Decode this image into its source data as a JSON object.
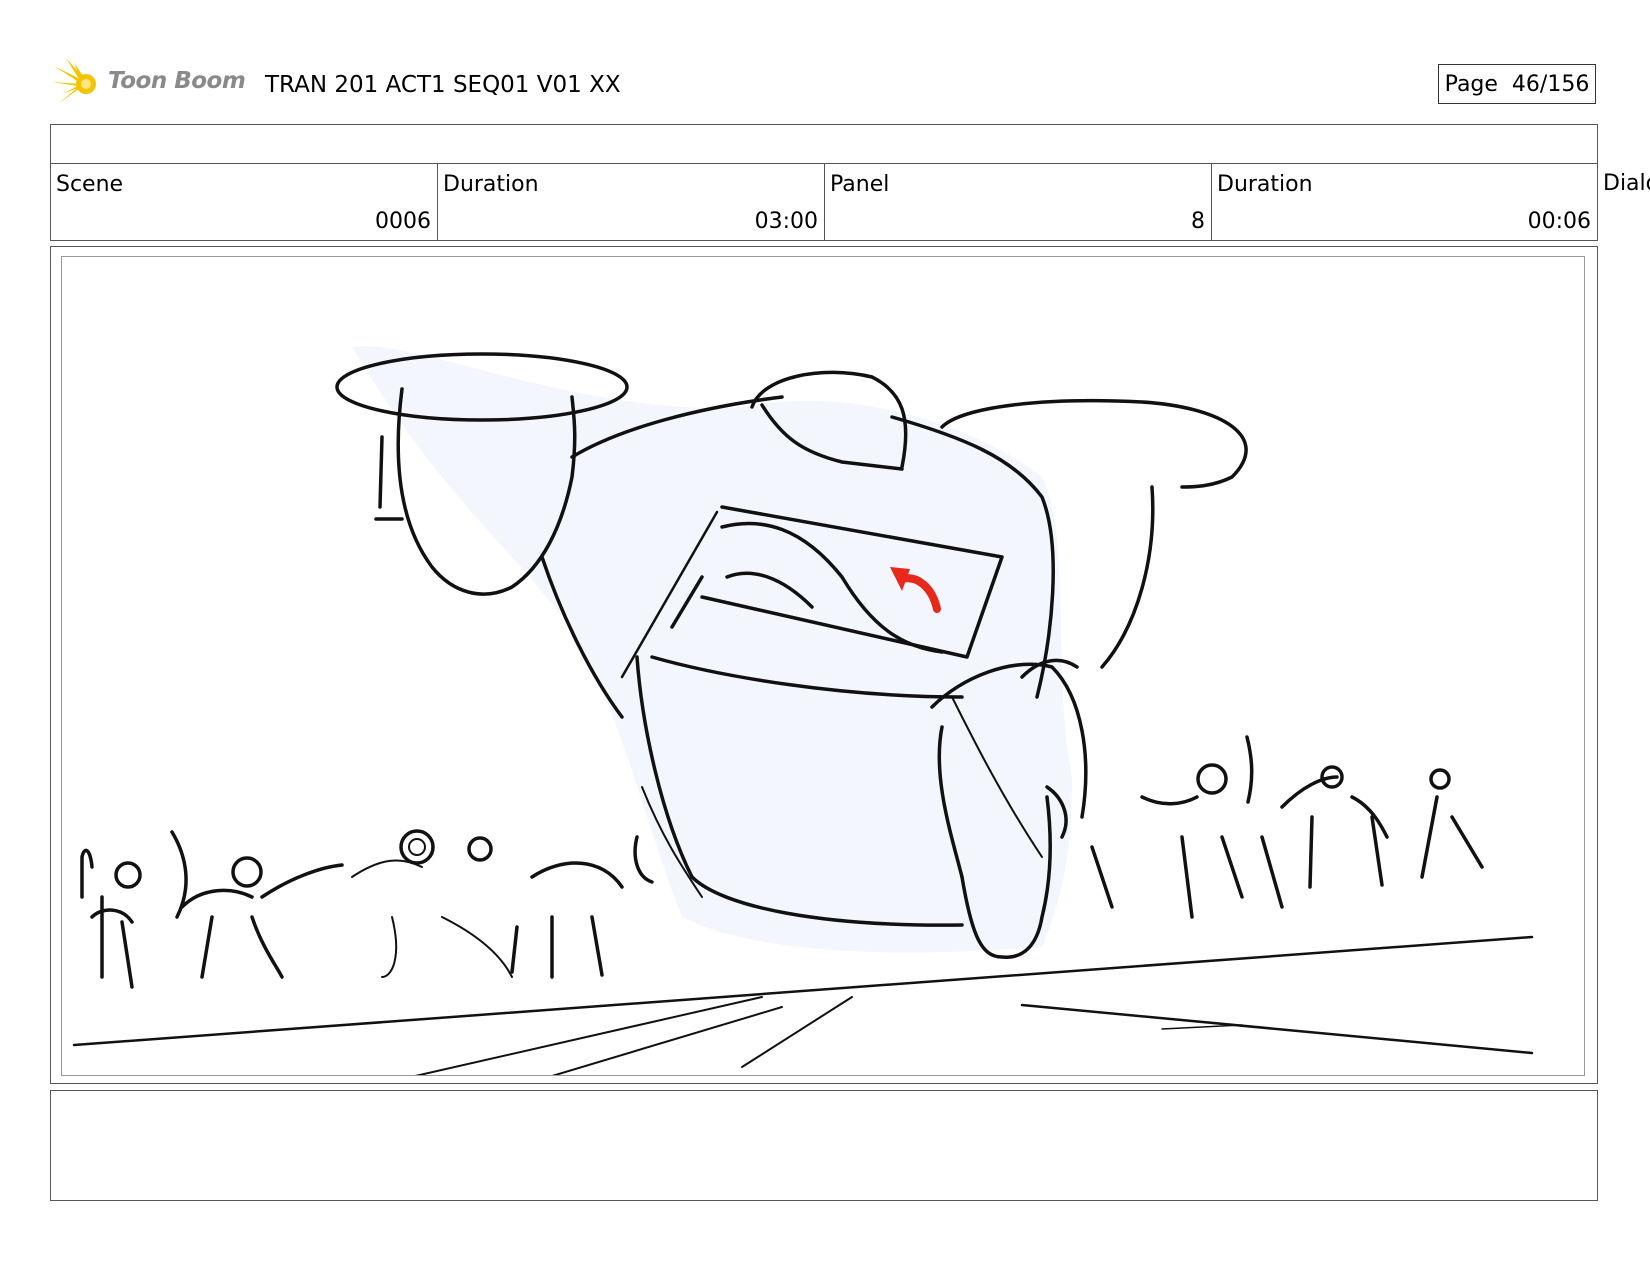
{
  "header": {
    "logo_text": "Toon Boom",
    "doc_title": "TRAN 201 ACT1 SEQ01 V01 XX",
    "page_label": "Page  46/156"
  },
  "info": {
    "scene_label": "Scene",
    "scene_value": "0006",
    "scene_duration_label": "Duration",
    "scene_duration_value": "03:00",
    "panel_label": "Panel",
    "panel_value": "8",
    "panel_duration_label": "Duration",
    "panel_duration_value": "00:06",
    "dialog_label": "Dialo"
  },
  "colors": {
    "logo_star": "#f5c400",
    "arrow_red": "#e8281a",
    "sketch_fill": "#f3f6fc"
  },
  "icons": {
    "logo": "toon-boom-starburst-icon",
    "motion": "red-curved-arrow-icon"
  }
}
